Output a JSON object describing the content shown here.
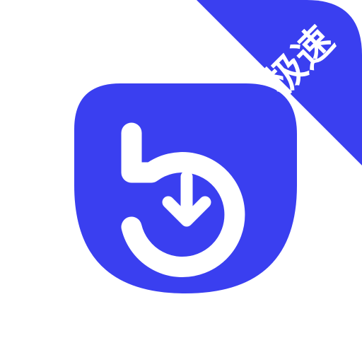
{
  "app_icon": {
    "badge_label": "极速",
    "colors": {
      "brand": "#3a3ff0",
      "foreground": "#ffffff",
      "background": "#ffffff"
    },
    "icon": "download-refresh-icon"
  }
}
